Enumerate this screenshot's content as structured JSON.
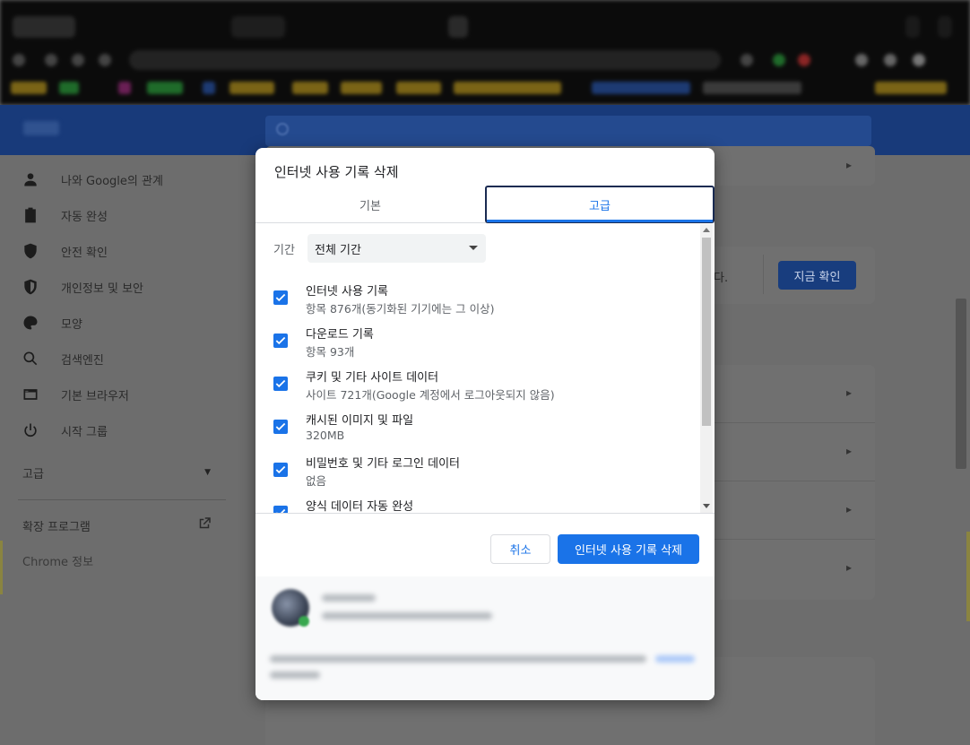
{
  "dialog": {
    "title": "인터넷 사용 기록 삭제",
    "tabs": [
      {
        "label": "기본",
        "selected": false
      },
      {
        "label": "고급",
        "selected": true
      }
    ],
    "time_range": {
      "label": "기간",
      "value": "전체 기간"
    },
    "items": [
      {
        "title": "인터넷 사용 기록",
        "subtitle": "항목 876개(동기화된 기기에는 그 이상)",
        "checked": true
      },
      {
        "title": "다운로드 기록",
        "subtitle": "항목 93개",
        "checked": true
      },
      {
        "title": "쿠키 및 기타 사이트 데이터",
        "subtitle": "사이트 721개(Google 계정에서 로그아웃되지 않음)",
        "checked": true
      },
      {
        "title": "캐시된 이미지 및 파일",
        "subtitle": "320MB",
        "checked": true
      },
      {
        "title": "비밀번호 및 기타 로그인 데이터",
        "subtitle": "없음",
        "checked": true
      },
      {
        "title": "양식 데이터 자동 완성",
        "subtitle": "",
        "checked": true
      }
    ],
    "buttons": {
      "cancel": "취소",
      "clear": "인터넷 사용 기록 삭제"
    }
  },
  "sidebar": {
    "items": [
      {
        "label": "나와 Google의 관계",
        "icon": "person-icon"
      },
      {
        "label": "자동 완성",
        "icon": "clipboard-icon"
      },
      {
        "label": "안전 확인",
        "icon": "shield-check-icon"
      },
      {
        "label": "개인정보 및 보안",
        "icon": "shield-icon"
      },
      {
        "label": "모양",
        "icon": "palette-icon"
      },
      {
        "label": "검색엔진",
        "icon": "search-icon"
      },
      {
        "label": "기본 브라우저",
        "icon": "browser-icon"
      },
      {
        "label": "시작 그룹",
        "icon": "power-icon"
      }
    ],
    "advanced": "고급",
    "extensions": "확장 프로그램",
    "about": "Chrome 정보"
  },
  "main": {
    "safety_check_text": "다.",
    "check_now_button": "지금 확인"
  },
  "colors": {
    "accent": "#1a73e8",
    "header": "#183a7a",
    "scrim_bg": "#6d6d6d"
  }
}
